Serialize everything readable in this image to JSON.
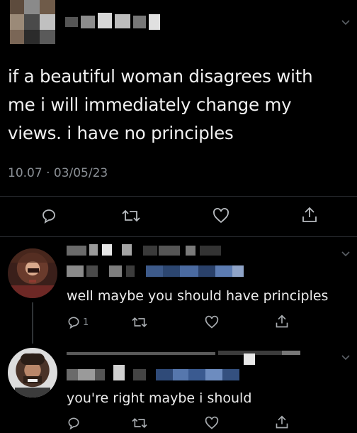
{
  "tweet": {
    "text": "if a beautiful woman disagrees with me i will immediately change my views. i have no principles",
    "meta": "10.07 · 03/05/23"
  },
  "replies": [
    {
      "text": "well maybe you should have principles",
      "reply_count": "1"
    },
    {
      "text": "you're right maybe i should"
    }
  ],
  "icons": {
    "reply": "reply-icon",
    "retweet": "retweet-icon",
    "like": "heart-icon",
    "share": "share-icon",
    "more": "chevron-down-icon"
  },
  "colors": {
    "background": "#000000",
    "text": "#e7e9ea",
    "muted": "#8b9096",
    "divider": "#2a2d31"
  }
}
